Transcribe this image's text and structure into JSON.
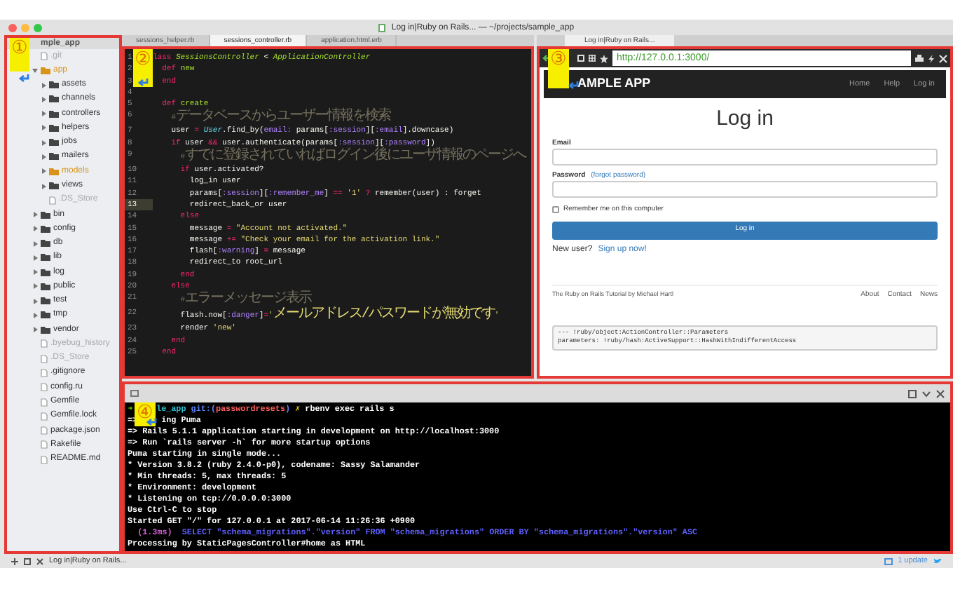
{
  "window": {
    "title": "Log in|Ruby on Rails... — ~/projects/sample_app"
  },
  "sidebar": {
    "callout": "①",
    "header": "mple_app",
    "tree": [
      {
        "label": ".git",
        "kind": "file",
        "dimmed": true
      },
      {
        "label": "app",
        "kind": "folder",
        "expanded": true,
        "modified": true,
        "children": [
          {
            "label": "assets",
            "kind": "folder",
            "expanded": false,
            "modified": false
          },
          {
            "label": "channels",
            "kind": "folder",
            "expanded": false,
            "modified": false
          },
          {
            "label": "controllers",
            "kind": "folder",
            "expanded": false,
            "modified": false
          },
          {
            "label": "helpers",
            "kind": "folder",
            "expanded": false,
            "modified": false
          },
          {
            "label": "jobs",
            "kind": "folder",
            "expanded": false,
            "modified": false
          },
          {
            "label": "mailers",
            "kind": "folder",
            "expanded": false,
            "modified": false
          },
          {
            "label": "models",
            "kind": "folder",
            "expanded": false,
            "modified": true
          },
          {
            "label": "views",
            "kind": "folder",
            "expanded": false,
            "modified": false
          },
          {
            "label": ".DS_Store",
            "kind": "file",
            "dimmed": true
          }
        ]
      },
      {
        "label": "bin",
        "kind": "folder",
        "expanded": false,
        "modified": false
      },
      {
        "label": "config",
        "kind": "folder",
        "expanded": false,
        "modified": false
      },
      {
        "label": "db",
        "kind": "folder",
        "expanded": false,
        "modified": false
      },
      {
        "label": "lib",
        "kind": "folder",
        "expanded": false,
        "modified": false
      },
      {
        "label": "log",
        "kind": "folder",
        "expanded": false,
        "modified": false
      },
      {
        "label": "public",
        "kind": "folder",
        "expanded": false,
        "modified": false
      },
      {
        "label": "test",
        "kind": "folder",
        "expanded": false,
        "modified": false
      },
      {
        "label": "tmp",
        "kind": "folder",
        "expanded": false,
        "modified": false
      },
      {
        "label": "vendor",
        "kind": "folder",
        "expanded": false,
        "modified": false
      },
      {
        "label": ".byebug_history",
        "kind": "file",
        "dimmed": true
      },
      {
        "label": ".DS_Store",
        "kind": "file",
        "dimmed": true
      },
      {
        "label": ".gitignore",
        "kind": "file",
        "dimmed": false
      },
      {
        "label": "config.ru",
        "kind": "file",
        "dimmed": false
      },
      {
        "label": "Gemfile",
        "kind": "file",
        "dimmed": false
      },
      {
        "label": "Gemfile.lock",
        "kind": "file",
        "dimmed": false
      },
      {
        "label": "package.json",
        "kind": "file",
        "dimmed": false
      },
      {
        "label": "Rakefile",
        "kind": "file",
        "dimmed": false
      },
      {
        "label": "README.md",
        "kind": "file",
        "dimmed": false
      }
    ]
  },
  "editor": {
    "callout": "②",
    "tabs": [
      {
        "label": "sessions_helper.rb",
        "selected": false
      },
      {
        "label": "sessions_controller.rb",
        "selected": true
      },
      {
        "label": "application.html.erb",
        "selected": false
      }
    ],
    "lines": [
      {
        "number": "1",
        "current": false,
        "tokens": [
          {
            "kind": "keyword",
            "text": "lass"
          },
          {
            "kind": "class",
            "text": " SessionsController"
          },
          {
            "kind": "plain",
            "text": " < "
          },
          {
            "kind": "class",
            "text": "ApplicationController"
          }
        ]
      },
      {
        "number": "2",
        "current": false,
        "tokens": [
          {
            "kind": "keyword",
            "text": "  def"
          },
          {
            "kind": "method",
            "text": " new"
          }
        ]
      },
      {
        "number": "3",
        "current": false,
        "tokens": [
          {
            "kind": "keyword",
            "text": "  end"
          }
        ]
      },
      {
        "number": "4",
        "current": false
      },
      {
        "number": "5",
        "current": false,
        "tokens": [
          {
            "kind": "keyword",
            "text": "  def"
          },
          {
            "kind": "method",
            "text": " create"
          }
        ]
      },
      {
        "number": "6",
        "current": false,
        "tokens": [
          {
            "kind": "comment",
            "text": "    #"
          },
          {
            "kind": "comment_cjk",
            "text": "データベースからユーザー情報を検索"
          }
        ]
      },
      {
        "number": "7",
        "current": false,
        "tokens": [
          {
            "kind": "plain",
            "text": "    user "
          },
          {
            "kind": "operator",
            "text": "="
          },
          {
            "kind": "constant",
            "text": " User"
          },
          {
            "kind": "plain",
            "text": ".find_by("
          },
          {
            "kind": "symbol",
            "text": "email:"
          },
          {
            "kind": "plain",
            "text": " params["
          },
          {
            "kind": "symbol",
            "text": ":session"
          },
          {
            "kind": "plain",
            "text": "]["
          },
          {
            "kind": "symbol",
            "text": ":email"
          },
          {
            "kind": "plain",
            "text": "].downcase)"
          }
        ]
      },
      {
        "number": "8",
        "current": false,
        "tokens": [
          {
            "kind": "keyword",
            "text": "    if"
          },
          {
            "kind": "plain",
            "text": " user "
          },
          {
            "kind": "operator",
            "text": "&&"
          },
          {
            "kind": "plain",
            "text": " user.authenticate(params["
          },
          {
            "kind": "symbol",
            "text": ":session"
          },
          {
            "kind": "plain",
            "text": "]["
          },
          {
            "kind": "symbol",
            "text": ":password"
          },
          {
            "kind": "plain",
            "text": "])"
          }
        ]
      },
      {
        "number": "9",
        "current": false,
        "tokens": [
          {
            "kind": "comment",
            "text": "      #"
          },
          {
            "kind": "comment_cjk",
            "text": "すでに登録されていればログイン後にユーザ情報のページへ"
          }
        ]
      },
      {
        "number": "10",
        "current": false,
        "tokens": [
          {
            "kind": "keyword",
            "text": "      if"
          },
          {
            "kind": "plain",
            "text": " user.activated?"
          }
        ]
      },
      {
        "number": "11",
        "current": false,
        "tokens": [
          {
            "kind": "plain",
            "text": "        log_in user"
          }
        ]
      },
      {
        "number": "12",
        "current": false,
        "tokens": [
          {
            "kind": "plain",
            "text": "        params["
          },
          {
            "kind": "symbol",
            "text": ":session"
          },
          {
            "kind": "plain",
            "text": "]["
          },
          {
            "kind": "symbol",
            "text": ":remember_me"
          },
          {
            "kind": "plain",
            "text": "] "
          },
          {
            "kind": "operator",
            "text": "=="
          },
          {
            "kind": "string",
            "text": " '1' "
          },
          {
            "kind": "operator",
            "text": "?"
          },
          {
            "kind": "plain",
            "text": " remember(user) : forget"
          }
        ]
      },
      {
        "number": "13",
        "current": true,
        "tokens": [
          {
            "kind": "plain",
            "text": "        redirect_back_or user"
          }
        ]
      },
      {
        "number": "14",
        "current": false,
        "tokens": [
          {
            "kind": "keyword",
            "text": "      else"
          }
        ]
      },
      {
        "number": "15",
        "current": false,
        "tokens": [
          {
            "kind": "plain",
            "text": "        message "
          },
          {
            "kind": "operator",
            "text": "="
          },
          {
            "kind": "string",
            "text": " \"Account not activated.\""
          }
        ]
      },
      {
        "number": "16",
        "current": false,
        "tokens": [
          {
            "kind": "plain",
            "text": "        message "
          },
          {
            "kind": "operator",
            "text": "+="
          },
          {
            "kind": "string",
            "text": " \"Check your email for the activation link.\""
          }
        ]
      },
      {
        "number": "17",
        "current": false,
        "tokens": [
          {
            "kind": "plain",
            "text": "        flash["
          },
          {
            "kind": "symbol",
            "text": ":warning"
          },
          {
            "kind": "plain",
            "text": "] "
          },
          {
            "kind": "operator",
            "text": "="
          },
          {
            "kind": "plain",
            "text": " message"
          }
        ]
      },
      {
        "number": "18",
        "current": false,
        "tokens": [
          {
            "kind": "plain",
            "text": "        redirect_to root_url"
          }
        ]
      },
      {
        "number": "19",
        "current": false,
        "tokens": [
          {
            "kind": "keyword",
            "text": "      end"
          }
        ]
      },
      {
        "number": "20",
        "current": false,
        "tokens": [
          {
            "kind": "keyword",
            "text": "    else"
          }
        ]
      },
      {
        "number": "21",
        "current": false,
        "tokens": [
          {
            "kind": "comment",
            "text": "      #"
          },
          {
            "kind": "comment_cjk",
            "text": "エラーメッセージ表示"
          }
        ]
      },
      {
        "number": "22",
        "current": false,
        "tokens": [
          {
            "kind": "plain",
            "text": "      flash.now["
          },
          {
            "kind": "symbol",
            "text": ":danger"
          },
          {
            "kind": "plain",
            "text": "]"
          },
          {
            "kind": "operator",
            "text": "="
          },
          {
            "kind": "string",
            "text": "'"
          },
          {
            "kind": "string_cjk",
            "text": "メールアドレス/パスワードが無効です"
          },
          {
            "kind": "string",
            "text": "'"
          }
        ]
      },
      {
        "number": "23",
        "current": false,
        "tokens": [
          {
            "kind": "plain",
            "text": "      render "
          },
          {
            "kind": "string",
            "text": "'new'"
          }
        ]
      },
      {
        "number": "24",
        "current": false,
        "tokens": [
          {
            "kind": "keyword",
            "text": "    end"
          }
        ]
      },
      {
        "number": "25",
        "current": false,
        "tokens": [
          {
            "kind": "keyword",
            "text": "  end"
          }
        ]
      }
    ]
  },
  "browser": {
    "callout": "③",
    "tab": "Log in|Ruby on Rails...",
    "url": "http://127.0.0.1:3000/",
    "page": {
      "brand": "AMPLE APP",
      "nav": [
        "Home",
        "Help",
        "Log in"
      ],
      "heading": "Log in",
      "email_label": "Email",
      "password_label": "Password",
      "forgot_link": "(forgot password)",
      "remember": {
        "label": "Remember me on this computer",
        "checked": false
      },
      "submit": "Log in",
      "signup_prompt": "New user?",
      "signup_link": "Sign up now!",
      "footer_text": "The Ruby on Rails Tutorial by Michael Hartl",
      "footer_links": [
        "About",
        "Contact",
        "News"
      ],
      "debug_lines": [
        "--- !ruby/object:ActionController::Parameters",
        "parameters: !ruby/hash:ActiveSupport::HashWithIndifferentAccess"
      ]
    }
  },
  "terminal": {
    "callout": "④",
    "lines": [
      {
        "tokens": [
          {
            "kind": "prompt",
            "text": "➜"
          },
          {
            "kind": "dir",
            "text": "le_app",
            "gap_before": true
          },
          {
            "kind": "git",
            "text": " git:("
          },
          {
            "kind": "branch",
            "text": "passwordresets"
          },
          {
            "kind": "git",
            "text": ")"
          },
          {
            "kind": "dirty",
            "text": " ✗"
          },
          {
            "kind": "plain",
            "text": " rbenv exec rails s"
          }
        ]
      },
      {
        "tokens": [
          {
            "kind": "plain",
            "text": "=>"
          },
          {
            "kind": "plain",
            "text": "ing Puma",
            "gap_before": true
          }
        ]
      },
      {
        "tokens": [
          {
            "kind": "plain",
            "text": "=> Rails 5.1.1 application starting in development on http://localhost:3000"
          }
        ]
      },
      {
        "tokens": [
          {
            "kind": "plain",
            "text": "=> Run `rails server -h` for more startup options"
          }
        ]
      },
      {
        "tokens": [
          {
            "kind": "plain",
            "text": "Puma starting in single mode..."
          }
        ]
      },
      {
        "tokens": [
          {
            "kind": "plain",
            "text": "* Version 3.8.2 (ruby 2.4.0-p0), codename: Sassy Salamander"
          }
        ]
      },
      {
        "tokens": [
          {
            "kind": "plain",
            "text": "* Min threads: 5, max threads: 5"
          }
        ]
      },
      {
        "tokens": [
          {
            "kind": "plain",
            "text": "* Environment: development"
          }
        ]
      },
      {
        "tokens": [
          {
            "kind": "plain",
            "text": "* Listening on tcp://0.0.0.0:3000"
          }
        ]
      },
      {
        "tokens": [
          {
            "kind": "plain",
            "text": "Use Ctrl-C to stop"
          }
        ]
      },
      {
        "tokens": [
          {
            "kind": "plain",
            "text": "Started GET \"/\" for 127.0.0.1 at 2017-06-14 11:26:36 +0900"
          }
        ]
      },
      {
        "tokens": [
          {
            "kind": "timing",
            "text": "  (1.3ms)"
          },
          {
            "kind": "sql",
            "text": "  SELECT \"schema_migrations\".\"version\" FROM \"schema_migrations\" ORDER BY \"schema_migrations\".\"version\" ASC"
          }
        ]
      },
      {
        "tokens": [
          {
            "kind": "plain",
            "text": "Processing by StaticPagesController#home as HTML"
          }
        ]
      }
    ]
  },
  "status_bar": {
    "tab": "Log in|Ruby on Rails...",
    "updates": "1 update"
  }
}
